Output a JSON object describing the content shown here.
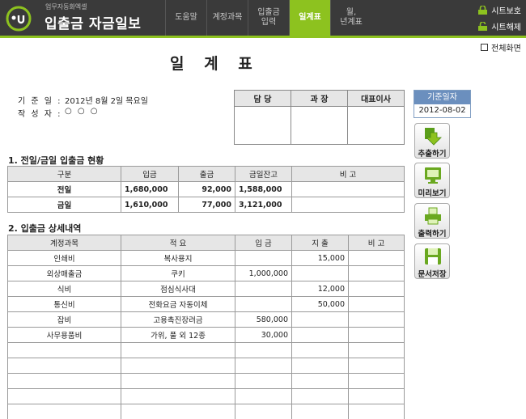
{
  "header": {
    "subtitle": "업무자동화엑셀",
    "title": "입출금 자금일보",
    "tabs": [
      {
        "label": "도움말",
        "active": false
      },
      {
        "label": "계정과목",
        "active": false
      },
      {
        "label": "입출금\n입력",
        "active": false
      },
      {
        "label": "일계표",
        "active": true
      },
      {
        "label": "월,\n년계표",
        "active": false
      }
    ],
    "protect_label": "시트보호",
    "unprotect_label": "시트해제",
    "accent_color": "#8dc21f"
  },
  "fullscreen_label": "전체화면",
  "doc_title": "일 계 표",
  "info": {
    "date_label": "기 준 일 :",
    "date_value": "2012년 8월 2일 목요일",
    "writer_label": "작 성 자 :",
    "writer_value": "○ ○ ○"
  },
  "approval": {
    "headers": [
      "담 당",
      "과 장",
      "대표이사"
    ]
  },
  "base_date": {
    "label": "기준일자",
    "value": "2012-08-02"
  },
  "section1": {
    "title": "1. 전일/금일 입출금 현황",
    "headers": [
      "구분",
      "입금",
      "출금",
      "금일잔고",
      "비 고"
    ],
    "rows": [
      [
        "전일",
        "1,680,000",
        "92,000",
        "1,588,000",
        ""
      ],
      [
        "금일",
        "1,610,000",
        "77,000",
        "3,121,000",
        ""
      ]
    ]
  },
  "section2": {
    "title": "2. 입출금 상세내역",
    "headers": [
      "계정과목",
      "적          요",
      "입   금",
      "지   출",
      "비   고"
    ],
    "rows": [
      [
        "인쇄비",
        "복사용지",
        "",
        "15,000",
        ""
      ],
      [
        "외상매출금",
        "쿠키",
        "1,000,000",
        "",
        ""
      ],
      [
        "식비",
        "점심식사대",
        "",
        "12,000",
        ""
      ],
      [
        "통신비",
        "전화요금 자동이체",
        "",
        "50,000",
        ""
      ],
      [
        "잡비",
        "고용촉진장려금",
        "580,000",
        "",
        ""
      ],
      [
        "사무용품비",
        "가위, 풀 외 12종",
        "30,000",
        "",
        ""
      ],
      [
        "",
        "",
        "",
        "",
        ""
      ],
      [
        "",
        "",
        "",
        "",
        ""
      ],
      [
        "",
        "",
        "",
        "",
        ""
      ],
      [
        "",
        "",
        "",
        "",
        ""
      ],
      [
        "",
        "",
        "",
        "",
        ""
      ]
    ]
  },
  "side_buttons": {
    "extract": "추출하기",
    "preview": "미리보기",
    "print": "출력하기",
    "save": "문서저장"
  }
}
